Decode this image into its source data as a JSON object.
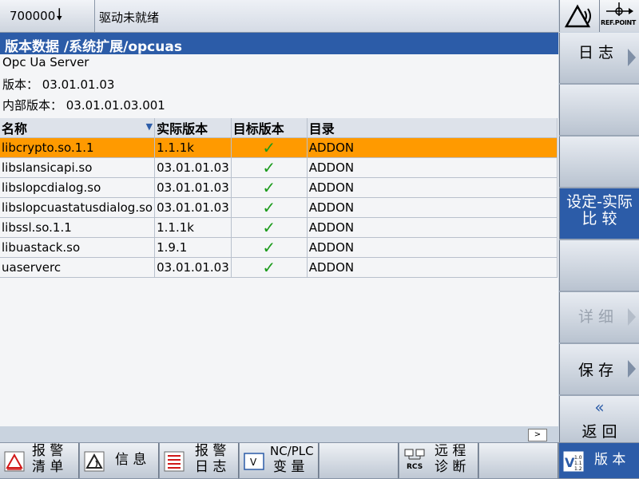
{
  "header": {
    "alarm_number": "700000",
    "status_text": "驱动未就绪",
    "refpoint_label": "REF.POINT"
  },
  "title": "版本数据  /系统扩展/opcuas",
  "info": {
    "product": "Opc Ua Server",
    "version_line": "版本：  03.01.01.03",
    "internal_version_line": "内部版本：  03.01.01.03.001"
  },
  "table": {
    "columns": [
      "名称",
      "实际版本",
      "目标版本",
      "目录"
    ],
    "rows": [
      {
        "name": "libcrypto.so.1.1",
        "actual": "1.1.1k",
        "target": "✓",
        "dir": "ADDON",
        "selected": true
      },
      {
        "name": "libslansicapi.so",
        "actual": "03.01.01.03",
        "target": "✓",
        "dir": "ADDON"
      },
      {
        "name": "libslopcdialog.so",
        "actual": "03.01.01.03",
        "target": "✓",
        "dir": "ADDON"
      },
      {
        "name": "libslopcuastatusdialog.so",
        "actual": "03.01.01.03",
        "target": "✓",
        "dir": "ADDON"
      },
      {
        "name": "libssl.so.1.1",
        "actual": "1.1.1k",
        "target": "✓",
        "dir": "ADDON"
      },
      {
        "name": "libuastack.so",
        "actual": "1.9.1",
        "target": "✓",
        "dir": "ADDON"
      },
      {
        "name": "uaserverc",
        "actual": "03.01.01.03",
        "target": "✓",
        "dir": "ADDON"
      }
    ]
  },
  "scroll_button": ">",
  "softkeys": {
    "log": "日 志",
    "compare_line1": "设定-实际",
    "compare_line2": "比    较",
    "details": "详 细",
    "save": "保 存",
    "back_arrow": "«",
    "back": "返 回"
  },
  "hotkeys": {
    "alarm_list_1": "报 警",
    "alarm_list_2": "清 单",
    "messages": "信 息",
    "alarm_log_1": "报 警",
    "alarm_log_2": "日 志",
    "ncplc_1": "NC/PLC",
    "ncplc_2": "变  量",
    "remote_1": "远 程",
    "remote_2": "诊 断",
    "version": "版 本"
  },
  "colors": {
    "title_bar": "#2c5ca8",
    "selected_row": "#ff9a00",
    "checkmark": "#1a9a1a"
  }
}
